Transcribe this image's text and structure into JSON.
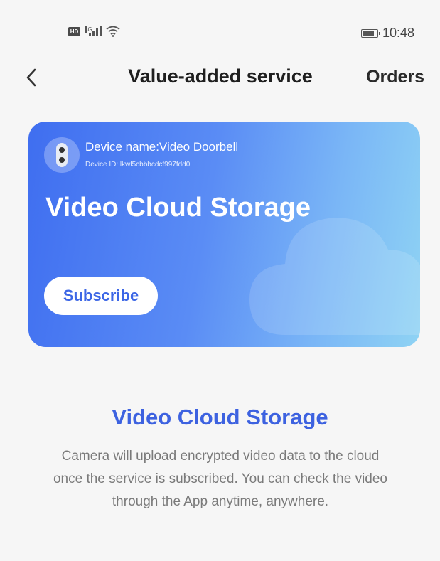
{
  "status_bar": {
    "signal_label": "4G",
    "time": "10:48"
  },
  "nav": {
    "title": "Value-added service",
    "orders_label": "Orders"
  },
  "card": {
    "device_name": "Device name:Video Doorbell",
    "device_id": "Device ID: lkwl5cbbbcdcf997fdd0",
    "title": "Video Cloud Storage",
    "subscribe_label": "Subscribe"
  },
  "description": {
    "title": "Video Cloud Storage",
    "text": "Camera will upload encrypted video data to the cloud once the service is subscribed. You can check the video through the App anytime, anywhere."
  },
  "colors": {
    "accent": "#3d62e0",
    "card_gradient_start": "#3f6ef0",
    "card_gradient_end": "#8fd3f4"
  },
  "icons": {
    "back": "chevron-left-icon",
    "device": "doorbell-icon",
    "wifi": "wifi-icon",
    "battery": "battery-icon"
  }
}
